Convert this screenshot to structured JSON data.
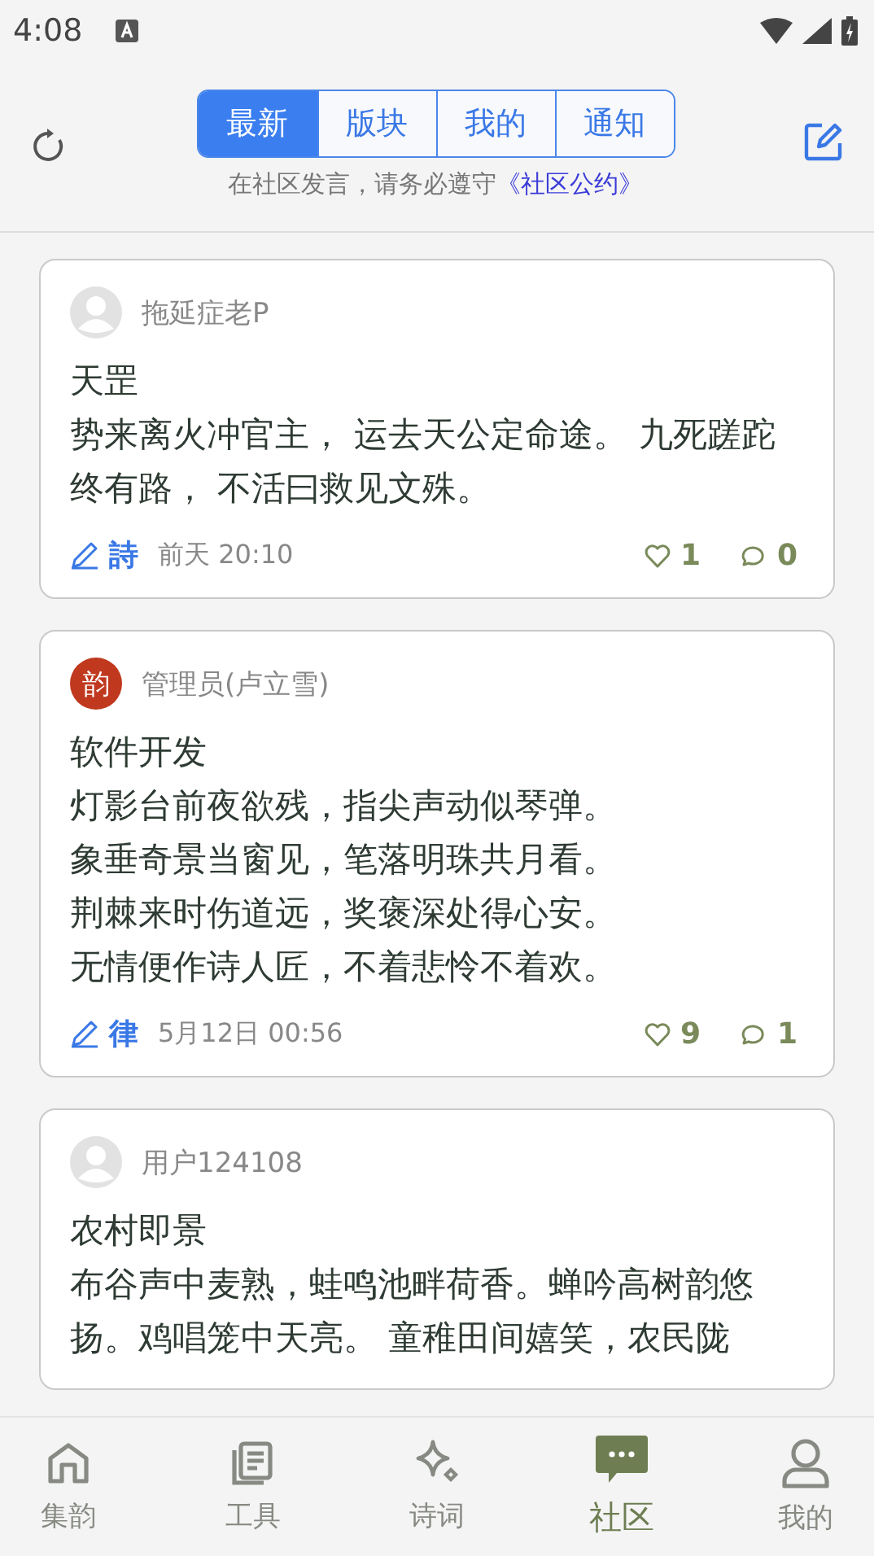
{
  "status_bar": {
    "time": "4:08"
  },
  "tabs": [
    {
      "label": "最新",
      "selected": true
    },
    {
      "label": "版块",
      "selected": false
    },
    {
      "label": "我的",
      "selected": false
    },
    {
      "label": "通知",
      "selected": false
    }
  ],
  "notice": {
    "text": "在社区发言，请务必遵守",
    "link": "《社区公约》"
  },
  "posts": [
    {
      "author": "拖延症老P",
      "avatar": {
        "kind": "default"
      },
      "title": "天罡",
      "body": "势来离火冲官主， 运去天公定命途。 九死蹉跎终有路， 不活曰救见文殊。",
      "form": "詩",
      "time": "前天 20:10",
      "likes": "1",
      "comments": "0"
    },
    {
      "author": "管理员(卢立雪)",
      "avatar": {
        "kind": "badge",
        "text": "韵"
      },
      "title": "软件开发",
      "lines": [
        "灯影台前夜欲残，指尖声动似琴弹。",
        "象垂奇景当窗见，笔落明珠共月看。",
        "荆棘来时伤道远，奖褒深处得心安。",
        "无情便作诗人匠，不着悲怜不着欢。"
      ],
      "form": "律",
      "time": "5月12日 00:56",
      "likes": "9",
      "comments": "1"
    },
    {
      "author": "用户124108",
      "avatar": {
        "kind": "default"
      },
      "title": "农村即景",
      "body": "布谷声中麦熟，蛙鸣池畔荷香。蝉吟高树韵悠扬。鸡唱笼中天亮。 童稚田间嬉笑，农民陇"
    }
  ],
  "nav": [
    {
      "label": "集韵",
      "kind": "home",
      "selected": false
    },
    {
      "label": "工具",
      "kind": "tools",
      "selected": false
    },
    {
      "label": "诗词",
      "kind": "poems",
      "selected": false
    },
    {
      "label": "社区",
      "kind": "community",
      "selected": true
    },
    {
      "label": "我的",
      "kind": "me",
      "selected": false
    }
  ]
}
